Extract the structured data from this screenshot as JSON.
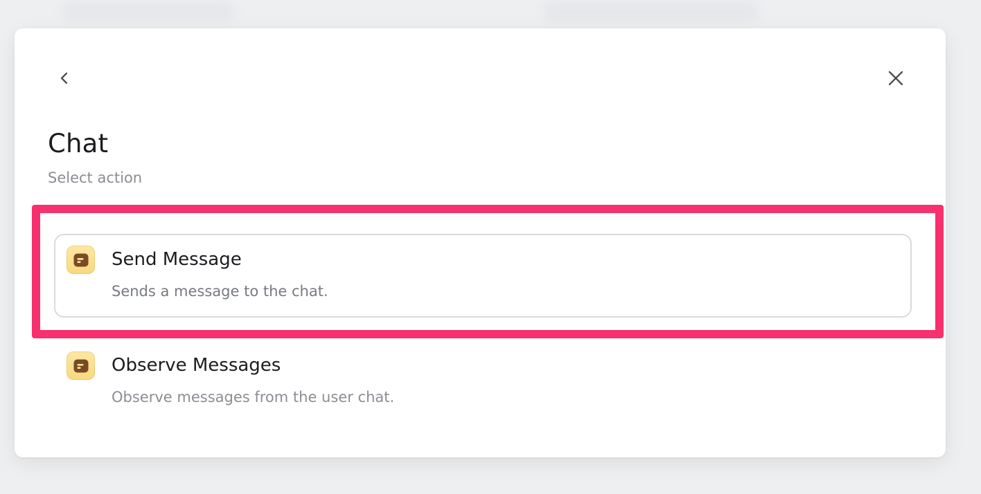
{
  "dialog": {
    "title": "Chat",
    "subtitle": "Select action"
  },
  "actions": [
    {
      "title": "Send Message",
      "description": "Sends a message to the chat.",
      "icon": "chat-app-icon",
      "highlighted": true
    },
    {
      "title": "Observe Messages",
      "description": "Observe messages from the user chat.",
      "icon": "chat-app-icon",
      "highlighted": false
    }
  ],
  "colors": {
    "highlight": "#f7306e",
    "icon_bg": "#f8d97e",
    "icon_fg": "#7a4a24"
  }
}
